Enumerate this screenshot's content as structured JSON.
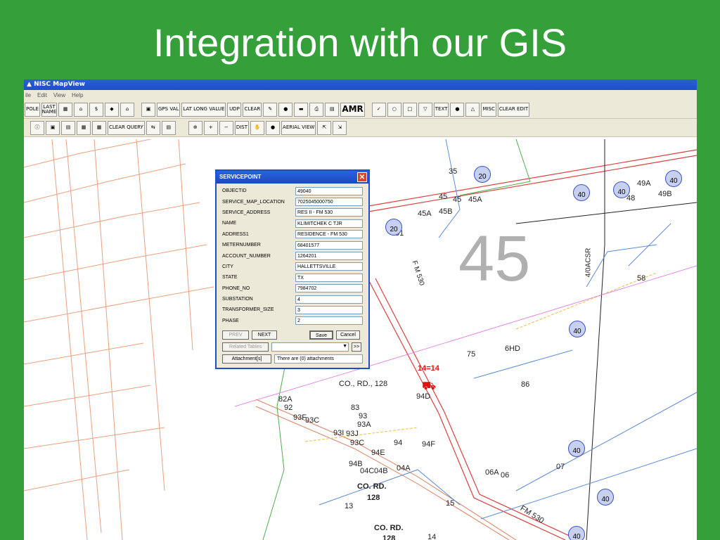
{
  "slide": {
    "title": "Integration with our GIS"
  },
  "app": {
    "title": "NISC MapView",
    "menu": [
      "ile",
      "Edit",
      "View",
      "Help"
    ]
  },
  "toolbar1": [
    "POLE",
    "LAST NAME",
    "",
    "",
    "",
    "",
    "",
    "",
    "GPS VAL",
    "LAT LONG VALUE",
    "UDP",
    "CLEAR",
    "",
    "",
    "",
    "",
    "",
    "AMR",
    "",
    "",
    "",
    "",
    "TEXT",
    "",
    "",
    "MISC",
    "CLEAR EDIT"
  ],
  "toolbar2": [
    "",
    "",
    "",
    "",
    "",
    "CLEAR QUERY",
    "",
    "",
    "",
    "",
    "",
    "DIST",
    "",
    "",
    "AERIAL VIEW",
    "",
    ""
  ],
  "dialog": {
    "title": "SERVICEPOINT",
    "fields": [
      {
        "name": "OBJECTID",
        "value": "49040"
      },
      {
        "name": "SERVICE_MAP_LOCATION",
        "value": "7025045000750"
      },
      {
        "name": "SERVICE_ADDRESS",
        "value": "RES II - FM 530"
      },
      {
        "name": "NAME",
        "value": "KLIMITCHEK  C      TJR"
      },
      {
        "name": "ADDRESS1",
        "value": "RESIDENCE - FM 530"
      },
      {
        "name": "METERNUMBER",
        "value": "68401577"
      },
      {
        "name": "ACCOUNT_NUMBER",
        "value": "1264201"
      },
      {
        "name": "CITY",
        "value": "HALLETTSVILLE"
      },
      {
        "name": "STATE",
        "value": "TX"
      },
      {
        "name": "PHONE_NO",
        "value": "7984702"
      },
      {
        "name": "SUBSTATION",
        "value": "4"
      },
      {
        "name": "TRANSFORMER_SIZE",
        "value": "3"
      },
      {
        "name": "PHASE",
        "value": "2"
      }
    ],
    "prev": "PREV",
    "next": "NEXT",
    "save": "Save",
    "cancel": "Cancel",
    "related_tables": "Related Tables",
    "more": ">>",
    "attachments": "Attachment[s]",
    "attachments_status": "There are (0) attachments"
  },
  "map": {
    "big_label": "45",
    "labels": [
      "35",
      "45",
      "45",
      "45A",
      "45B",
      "45A",
      "58",
      "49A",
      "49B",
      "48",
      "75",
      "6HD",
      "86",
      "14=14",
      "94D",
      "CO., RD., 128",
      "82A",
      "92",
      "93F",
      "93C",
      "83",
      "93",
      "93A",
      "93I",
      "93J",
      "93C",
      "94",
      "94F",
      "94E",
      "94B",
      "04C",
      "04B",
      "04A",
      "06A",
      "06",
      "07",
      "CO. RD.",
      "128",
      "13",
      "15",
      "FM 530",
      "CO. RD.",
      "128",
      "14",
      "F M  530",
      "4/0ACSR",
      "51"
    ],
    "transformers": [
      "20",
      "20",
      "40",
      "40",
      "40",
      "40",
      "40",
      "40",
      "40"
    ]
  }
}
